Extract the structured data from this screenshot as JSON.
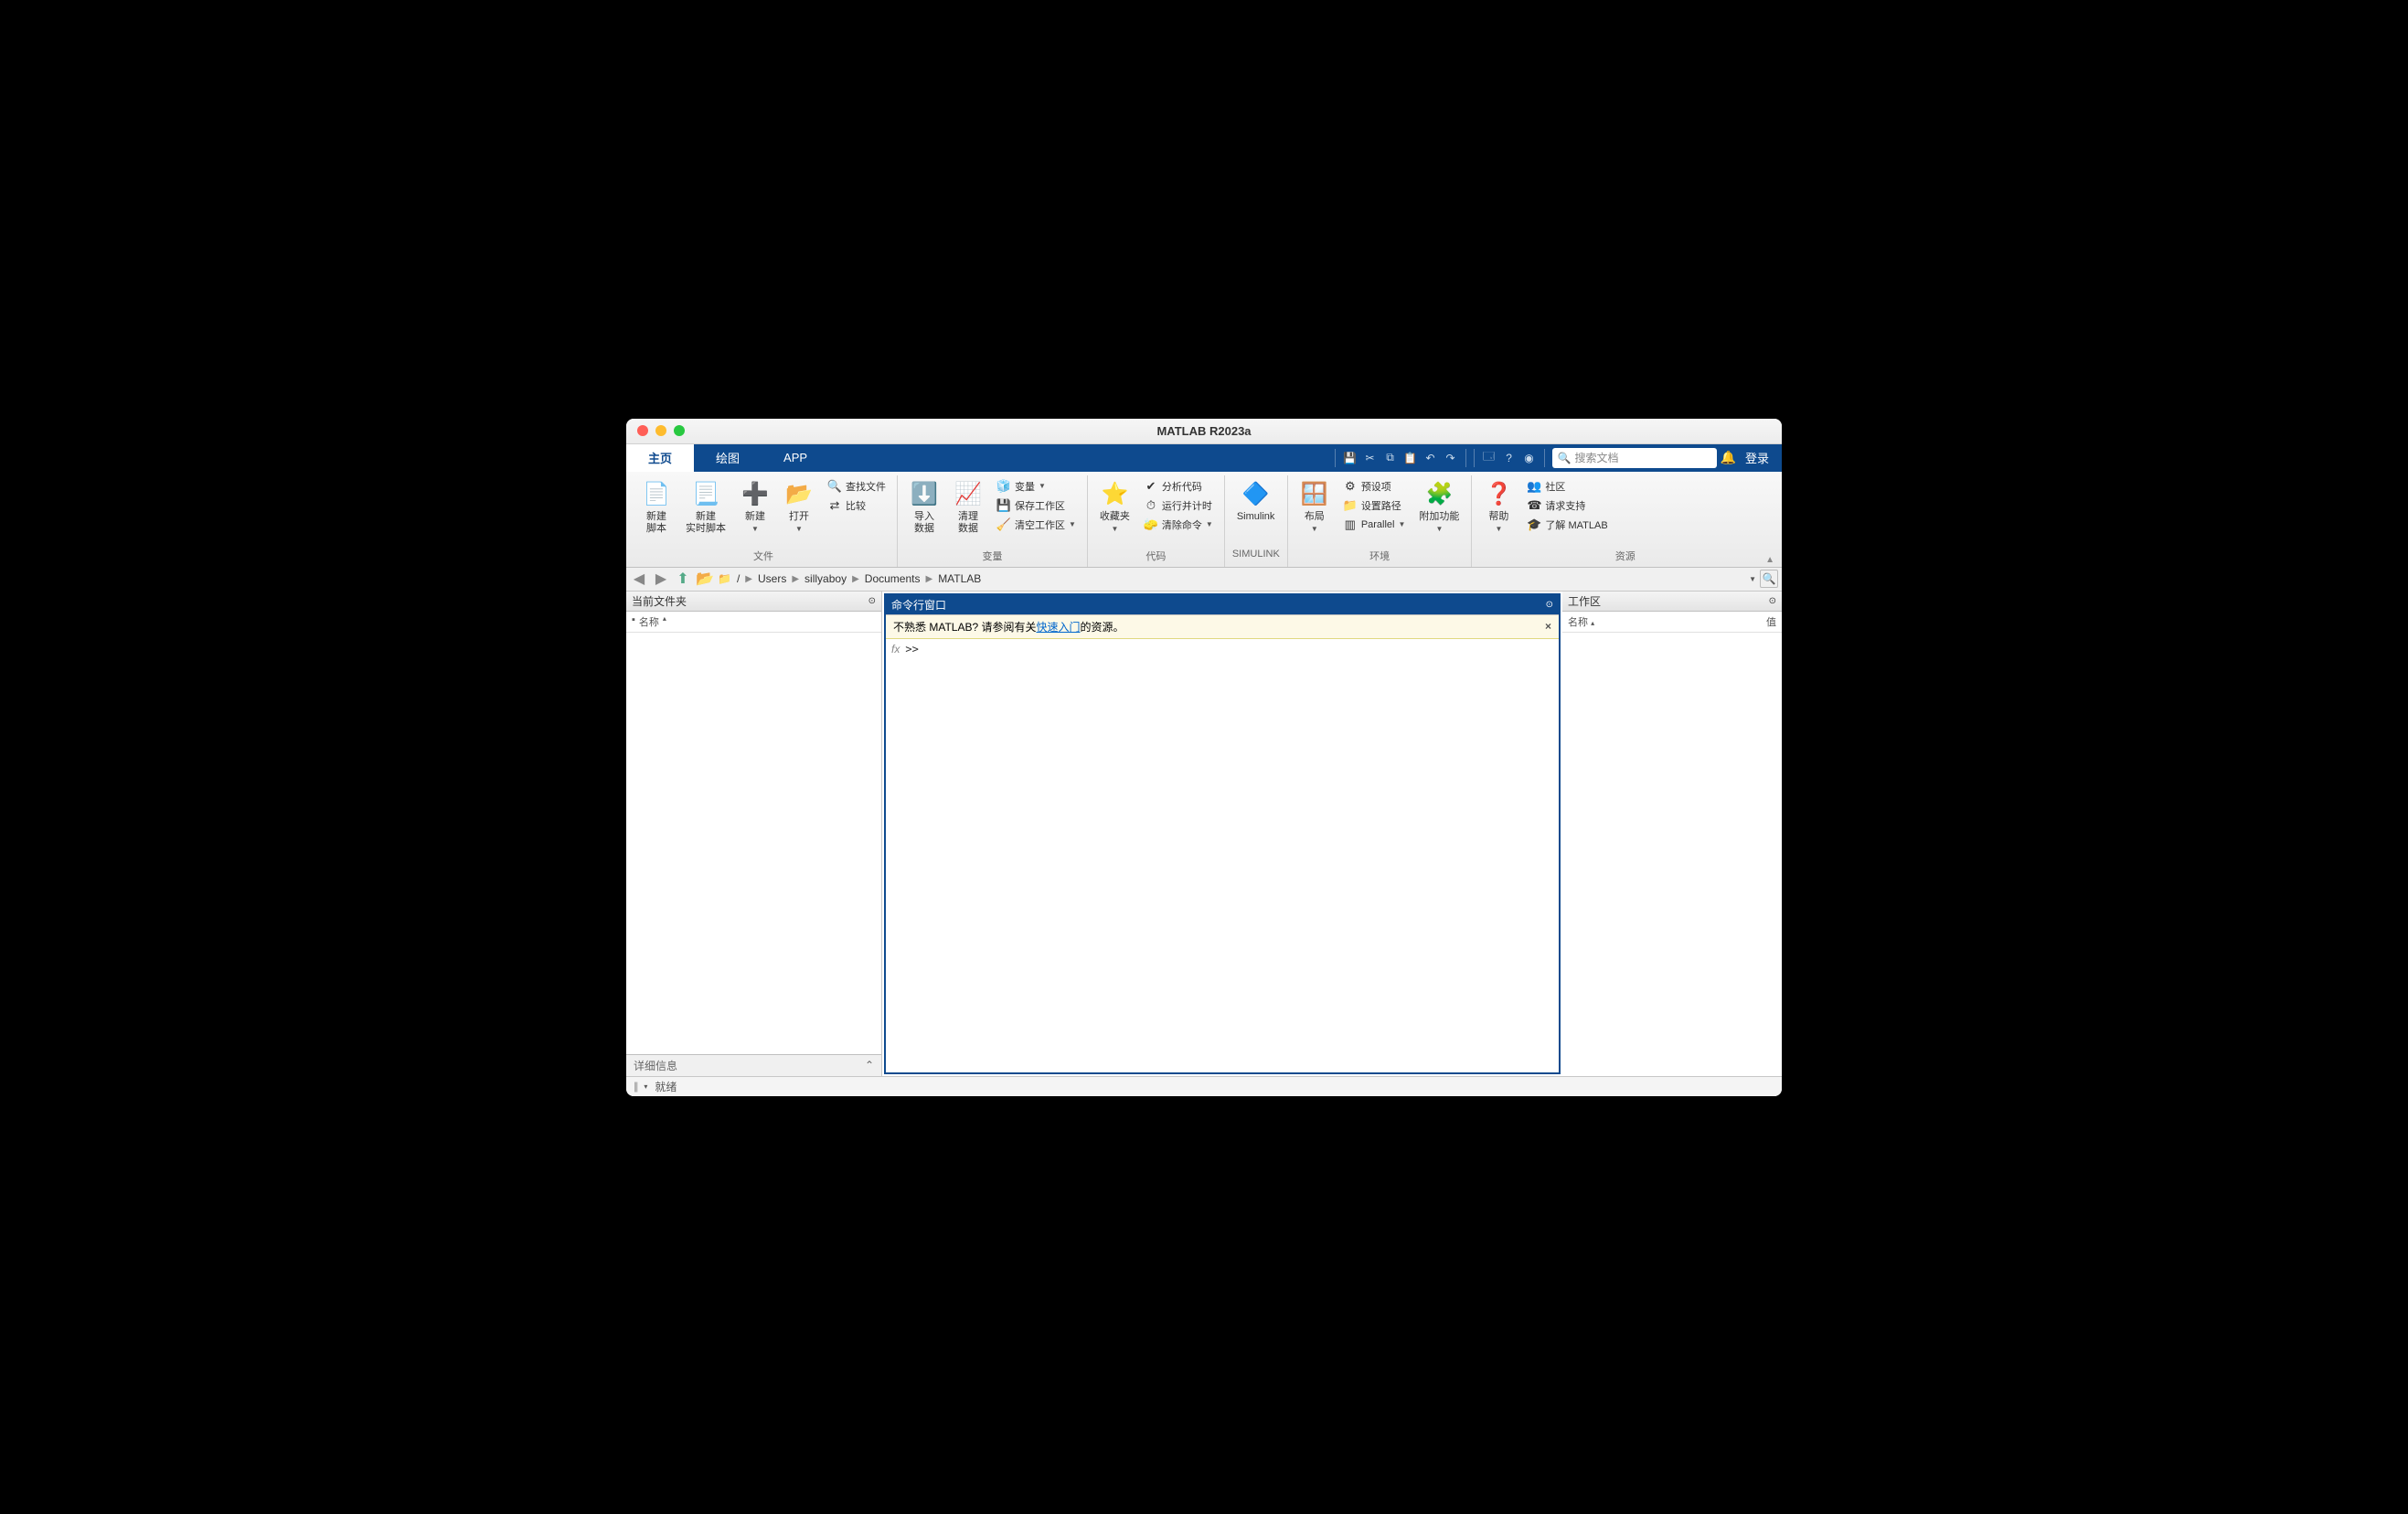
{
  "window": {
    "title": "MATLAB R2023a"
  },
  "tabs": {
    "home": "主页",
    "plots": "绘图",
    "apps": "APP"
  },
  "search": {
    "placeholder": "搜索文档"
  },
  "login": "登录",
  "ribbon": {
    "file": {
      "label": "文件",
      "new_script": "新建\n脚本",
      "new_live": "新建\n实时脚本",
      "new": "新建",
      "open": "打开",
      "find_files": "查找文件",
      "compare": "比较"
    },
    "variable": {
      "label": "变量",
      "import": "导入\n数据",
      "clean": "清理\n数据",
      "var": "变量",
      "save_ws": "保存工作区",
      "clear_ws": "清空工作区"
    },
    "code": {
      "label": "代码",
      "favorites": "收藏夹",
      "analyze": "分析代码",
      "run_time": "运行并计时",
      "clear_cmd": "清除命令"
    },
    "simulink": {
      "label": "SIMULINK",
      "btn": "Simulink"
    },
    "env": {
      "label": "环境",
      "layout": "布局",
      "prefs": "预设项",
      "set_path": "设置路径",
      "parallel": "Parallel",
      "addons": "附加功能"
    },
    "res": {
      "label": "资源",
      "help": "帮助",
      "community": "社区",
      "support": "请求支持",
      "learn": "了解 MATLAB"
    }
  },
  "path": {
    "segments": [
      "/",
      "Users",
      "sillyaboy",
      "Documents",
      "MATLAB"
    ]
  },
  "panels": {
    "current_folder": {
      "title": "当前文件夹",
      "col_name": "名称",
      "details": "详细信息"
    },
    "command": {
      "title": "命令行窗口",
      "banner_pre": "不熟悉 MATLAB? 请参阅有关",
      "banner_link": "快速入门",
      "banner_post": "的资源。",
      "prompt": ">>"
    },
    "workspace": {
      "title": "工作区",
      "col_name": "名称",
      "col_value": "值"
    }
  },
  "status": {
    "ready": "就绪"
  }
}
